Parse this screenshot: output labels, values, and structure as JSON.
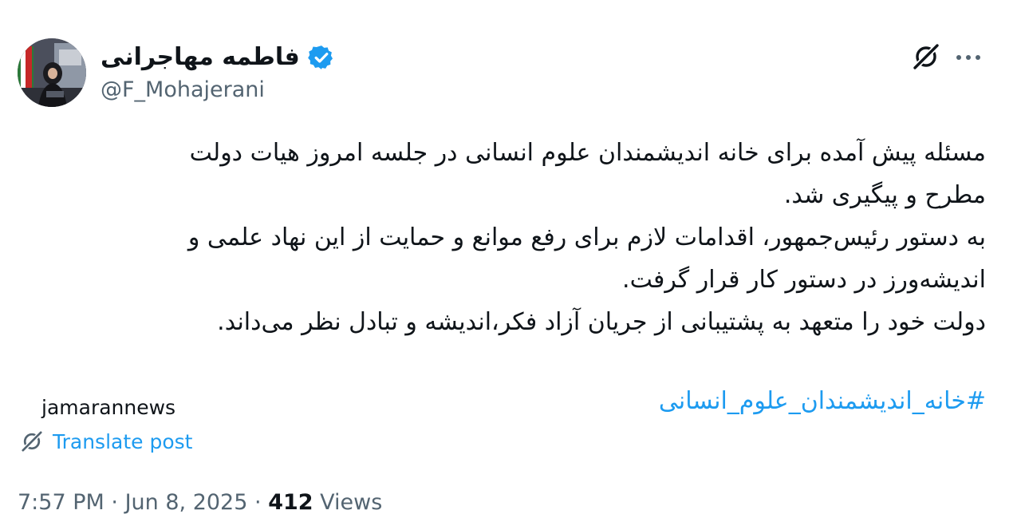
{
  "author": {
    "display_name": "فاطمه مهاجرانی",
    "handle": "@F_Mohajerani",
    "verified_color": "#1d9bf0"
  },
  "tweet": {
    "lines": [
      "مسئله پیش آمده برای خانه اندیشمندان علوم انسانی در جلسه امروز هیات دولت",
      "مطرح و پیگیری شد.",
      "به دستور رئیس‌جمهور، اقدامات لازم برای رفع موانع و حمایت از این نهاد علمی و",
      "اندیشه‌ورز در دستور کار قرار گرفت.",
      "دولت خود را متعهد به پشتیبانی از جریان آزاد فکر،اندیشه و تبادل نظر می‌داند."
    ],
    "hashtag": "#خانه_اندیشمندان_علوم_انسانی"
  },
  "source_label": "jamarannews",
  "translate_label": "Translate post",
  "meta": {
    "time": "7:57 PM",
    "separator": "·",
    "date": "Jun 8, 2025",
    "views_count": "412",
    "views_label": "Views"
  },
  "icons": {
    "avatar": "avatar-photo",
    "verified": "verified-badge-icon",
    "grok": "grok-icon",
    "more": "more-options-icon",
    "translate": "translate-icon"
  },
  "colors": {
    "accent": "#1d9bf0",
    "text": "#0f1419",
    "secondary": "#536471"
  }
}
